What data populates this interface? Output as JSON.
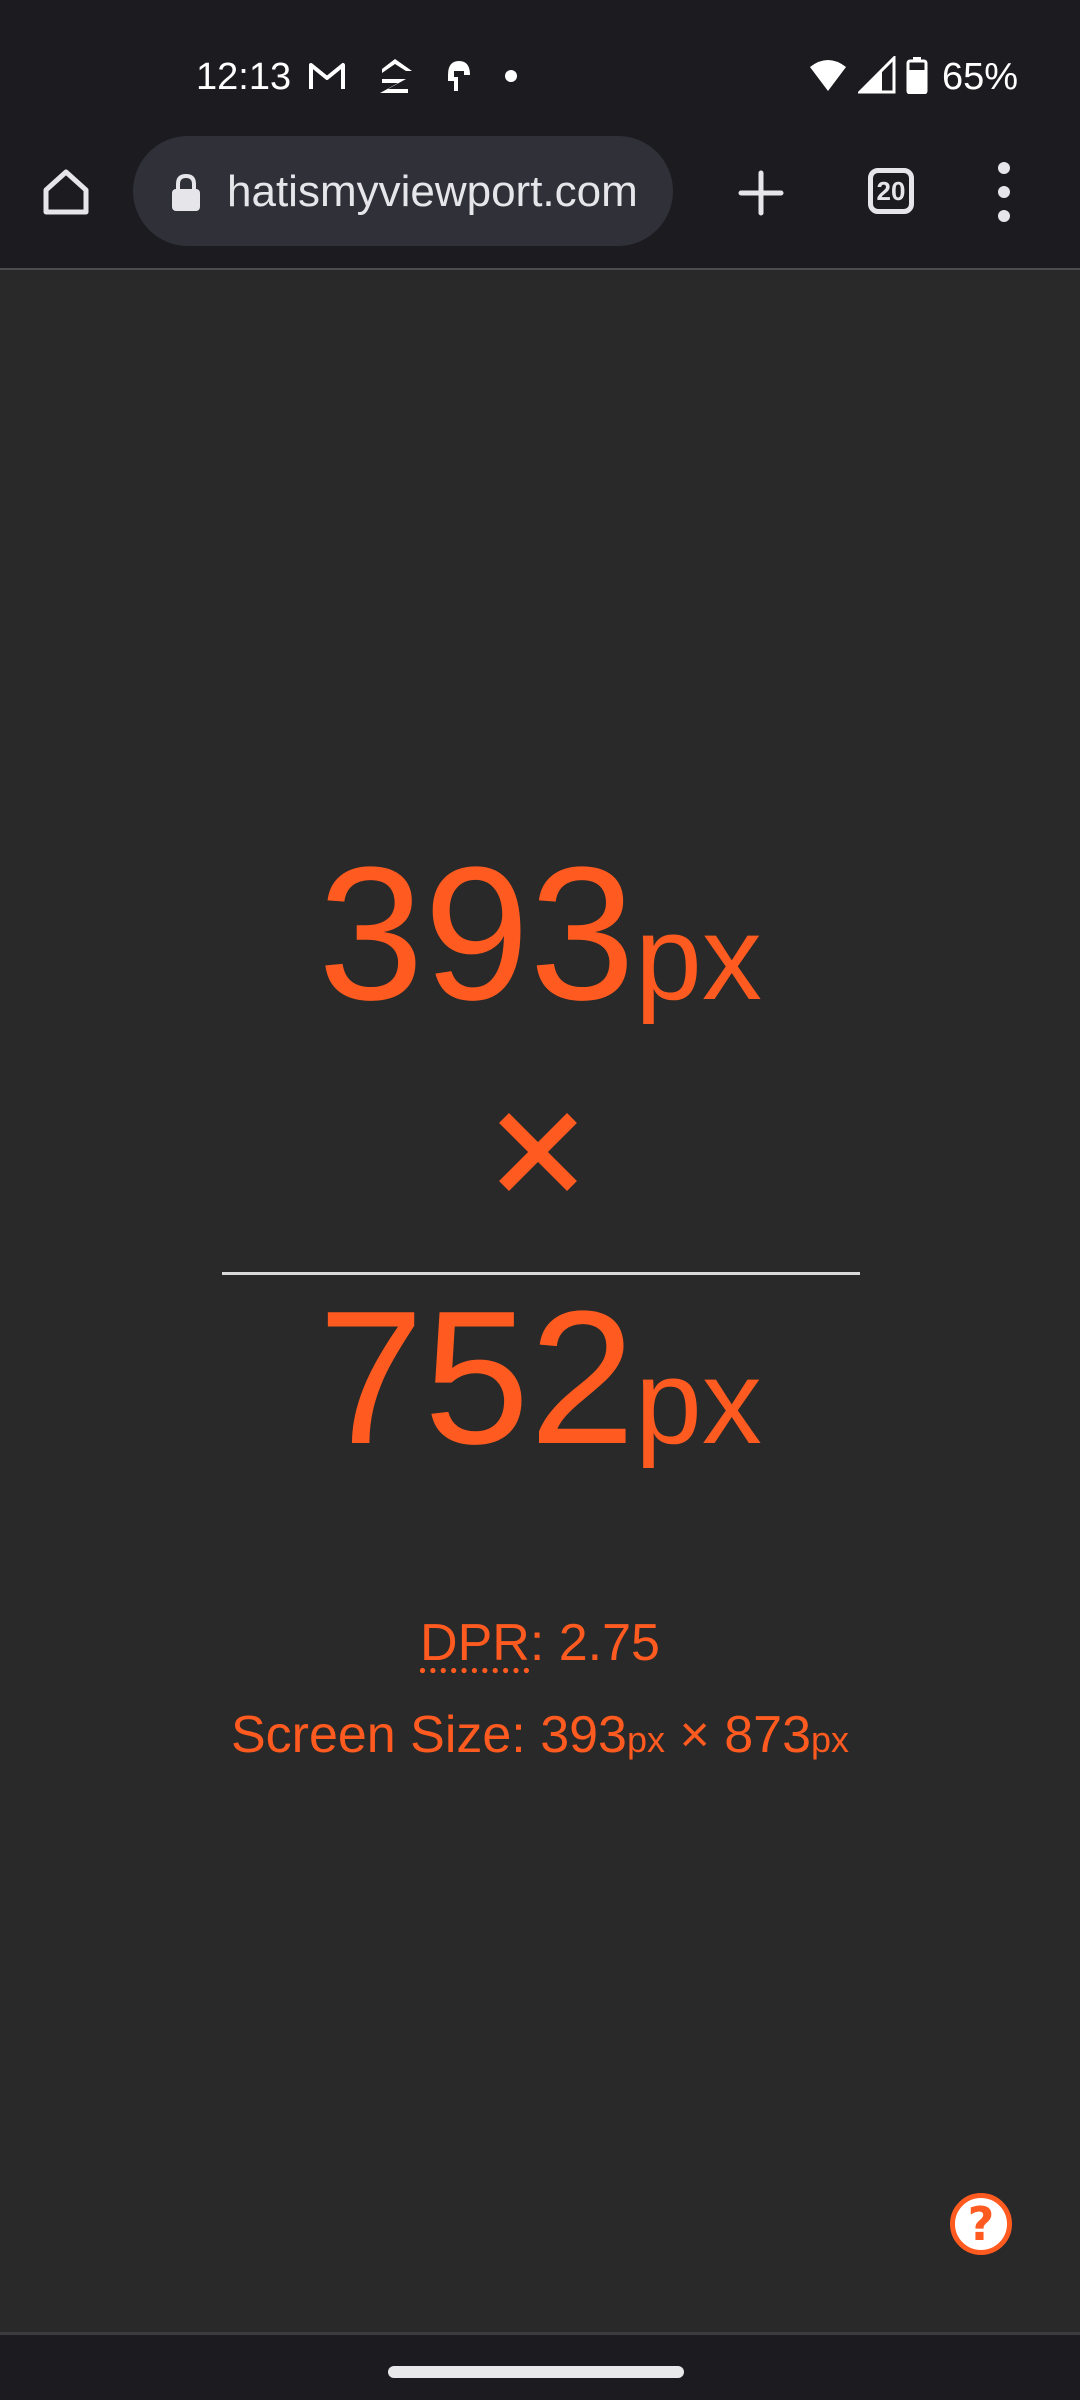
{
  "status_bar": {
    "time": "12:13",
    "battery": "65%",
    "icons": [
      "gmail-icon",
      "zillow-icon",
      "helmet-icon",
      "dot-icon",
      "wifi-icon",
      "signal-icon",
      "battery-icon"
    ]
  },
  "browser": {
    "url": "hatismyviewport.com",
    "tab_count": "20"
  },
  "viewport": {
    "width": "393",
    "height": "752",
    "unit": "px"
  },
  "info": {
    "dpr_label": "DPR",
    "dpr_sep": ": ",
    "dpr_value": "2.75",
    "screen_label": "Screen Size: ",
    "screen_width": "393",
    "screen_height": "873",
    "unit": "px",
    "times": " × "
  },
  "help": {
    "label": "?"
  },
  "colors": {
    "accent": "#ff5a1f",
    "page_bg": "#292929",
    "chrome_bg": "#1c1b20",
    "omnibox_bg": "#2f3038"
  }
}
